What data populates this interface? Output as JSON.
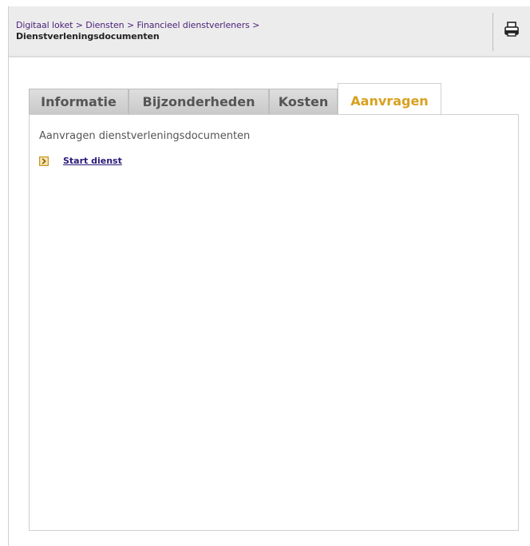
{
  "breadcrumb": {
    "items": [
      "Digitaal loket",
      "Diensten",
      "Financieel dienstverleners"
    ],
    "separator": ">",
    "current": "Dienstverleningsdocumenten"
  },
  "toolbar": {
    "print_icon": "printer-icon"
  },
  "tabs": [
    {
      "label": "Informatie",
      "active": false
    },
    {
      "label": "Bijzonderheden",
      "active": false
    },
    {
      "label": "Kosten",
      "active": false
    },
    {
      "label": "Aanvragen",
      "active": true
    }
  ],
  "panel": {
    "title": "Aanvragen dienstverleningsdocumenten",
    "start_link": "Start dienst",
    "start_icon": "arrow-right-box-icon"
  },
  "colors": {
    "active_tab_text": "#d8a020",
    "link": "#4b1f7a",
    "header_bg": "#ececec"
  }
}
